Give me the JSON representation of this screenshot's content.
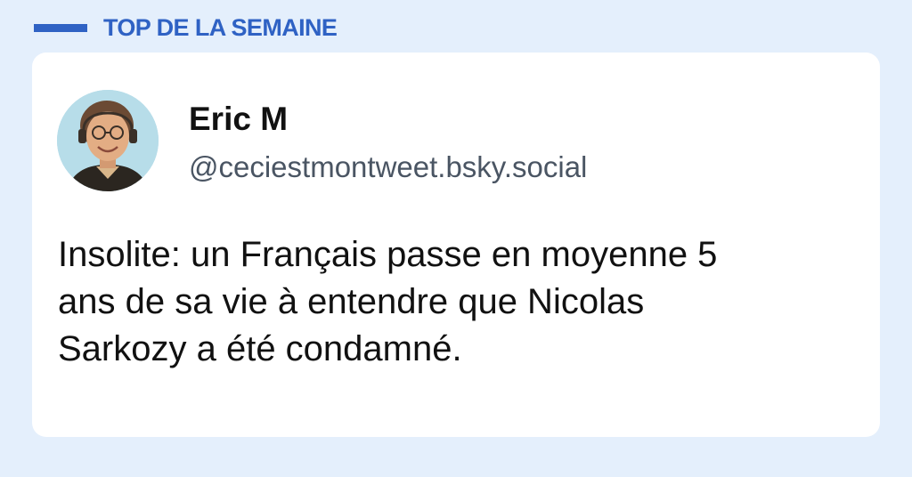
{
  "header": {
    "title": "TOP DE LA SEMAINE",
    "accent_color": "#2f62c4"
  },
  "post": {
    "author": {
      "name": "Eric M",
      "handle": "@ceciestmontweet.bsky.social",
      "avatar_icon": "user-avatar-photo"
    },
    "text_lines": [
      "Insolite: un Français passe en moyenne 5",
      "ans de sa vie à entendre que Nicolas",
      "Sarkozy a été condamné."
    ]
  }
}
